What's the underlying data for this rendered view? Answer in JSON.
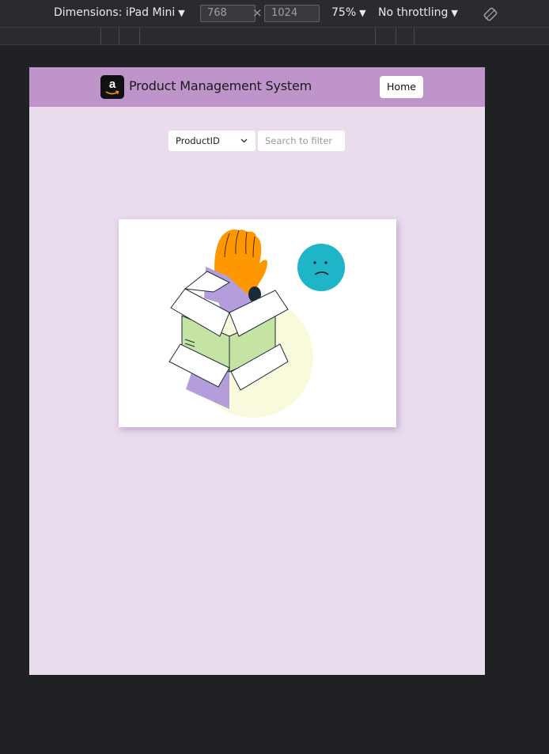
{
  "devtools": {
    "dimensions_label": "Dimensions: iPad Mini",
    "width": "768",
    "height": "1024",
    "zoom": "75%",
    "throttling": "No throttling",
    "x_separator": "×"
  },
  "app": {
    "brand_letter": "a",
    "title": "Product Management System",
    "home_label": "Home"
  },
  "filter": {
    "selected_field": "ProductID",
    "search_placeholder": "Search to filter"
  },
  "colors": {
    "navbar": "#bf94cb",
    "page_background": "#e9dced",
    "hand_orange": "#ff9800",
    "box_green": "#c5e3a3",
    "box_purple": "#b39ddb",
    "face_teal": "#1fb5c9",
    "sun_yellow": "#f9f9dc"
  },
  "illustration": {
    "name": "empty-box-no-products"
  }
}
